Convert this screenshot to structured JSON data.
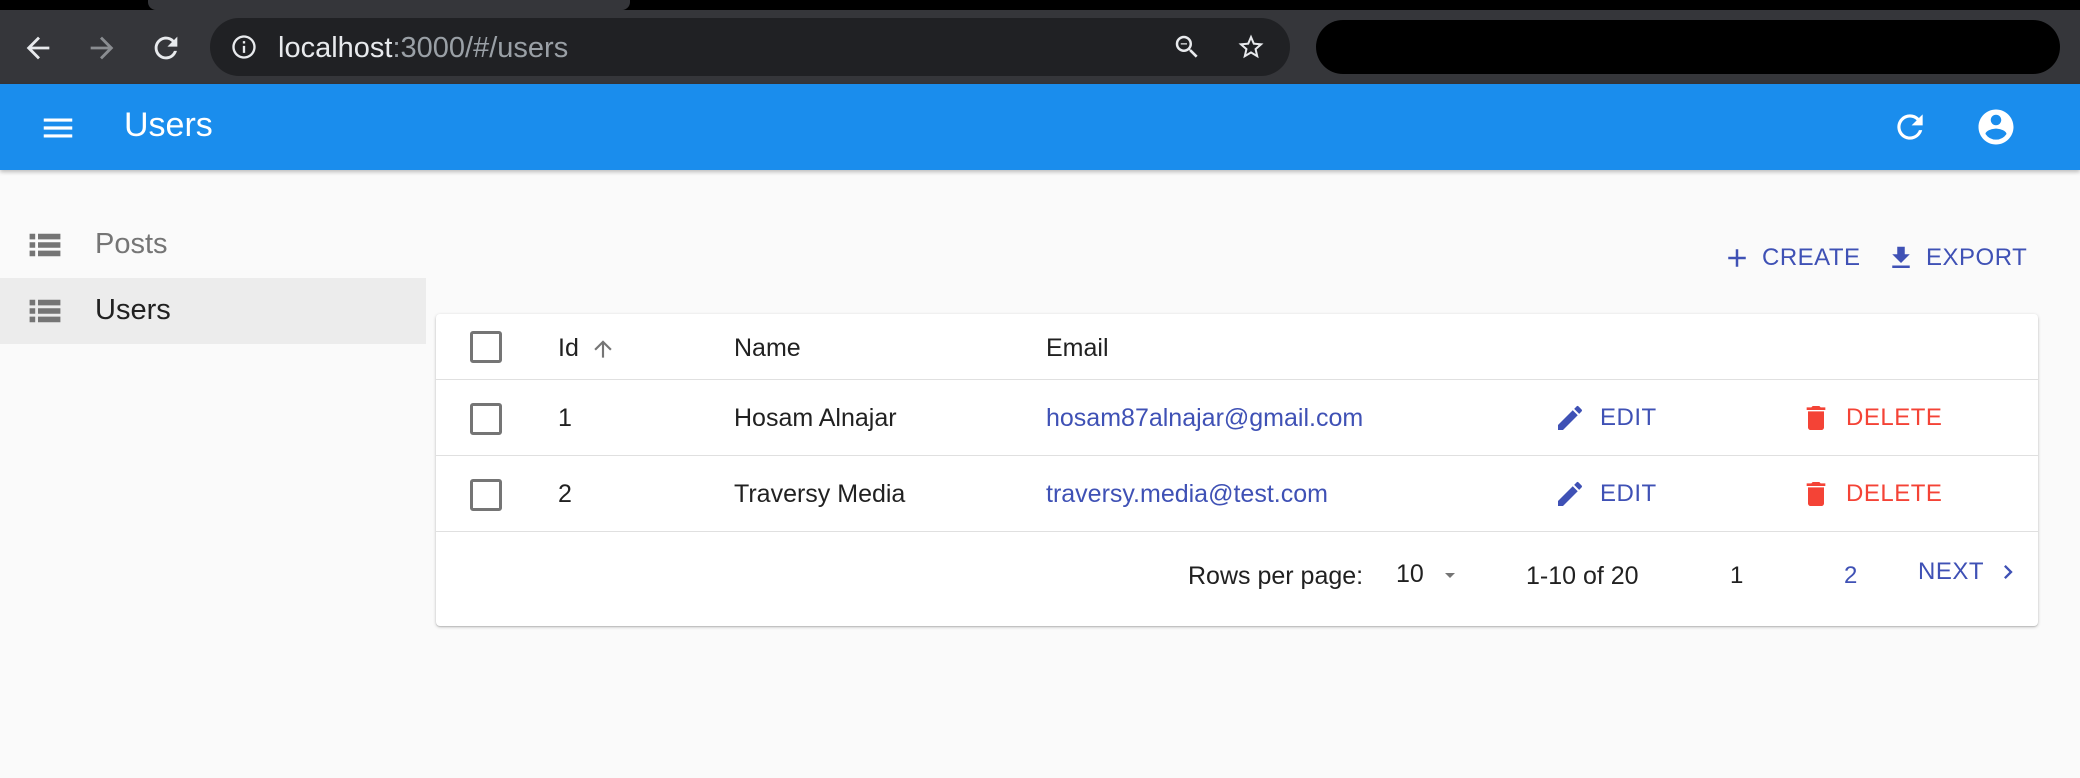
{
  "browser": {
    "url_host": "localhost",
    "url_rest": ":3000/#/users",
    "icons": [
      "back-arrow-icon",
      "forward-arrow-icon",
      "reload-icon",
      "info-icon",
      "zoom-out-icon",
      "star-icon"
    ]
  },
  "appbar": {
    "title": "Users",
    "color": "#1a8ded",
    "icons": [
      "menu-icon",
      "refresh-icon",
      "account-circle-icon"
    ]
  },
  "sidebar": {
    "items": [
      {
        "label": "Posts",
        "icon": "list-icon",
        "active": false
      },
      {
        "label": "Users",
        "icon": "list-icon",
        "active": true
      }
    ]
  },
  "actions": {
    "create_label": "CREATE",
    "export_label": "EXPORT"
  },
  "table": {
    "headers": {
      "id": "Id",
      "name": "Name",
      "email": "Email"
    },
    "sort": {
      "column": "Id",
      "direction": "ascending"
    },
    "rows": [
      {
        "id": "1",
        "name": "Hosam Alnajar",
        "email": "hosam87alnajar@gmail.com",
        "edit_label": "EDIT",
        "delete_label": "DELETE"
      },
      {
        "id": "2",
        "name": "Traversy Media",
        "email": "traversy.media@test.com",
        "edit_label": "EDIT",
        "delete_label": "DELETE"
      }
    ]
  },
  "pagination": {
    "rows_per_page_label": "Rows per page:",
    "rows_per_page_value": "10",
    "range_text": "1-10 of 20",
    "pages": [
      "1",
      "2"
    ],
    "current_page": "1",
    "next_label": "NEXT"
  },
  "colors": {
    "primary": "#3f51b5",
    "danger": "#f44336"
  }
}
